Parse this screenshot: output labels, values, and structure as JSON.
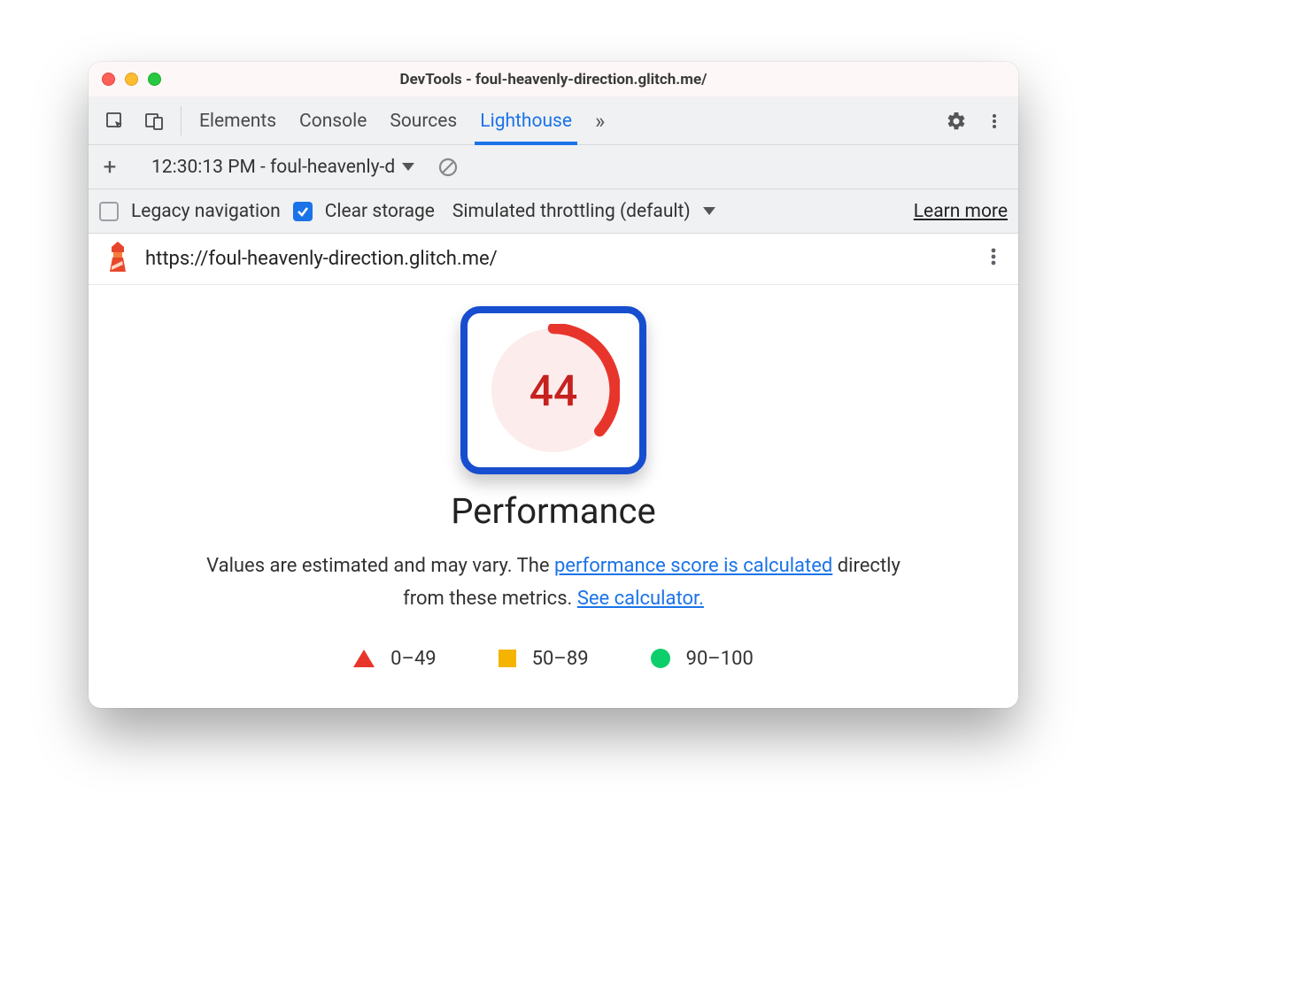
{
  "window": {
    "title": "DevTools - foul-heavenly-direction.glitch.me/"
  },
  "tabs": {
    "items": [
      "Elements",
      "Console",
      "Sources",
      "Lighthouse"
    ],
    "active": "Lighthouse"
  },
  "subbar1": {
    "report_select": "12:30:13 PM - foul-heavenly-d"
  },
  "subbar2": {
    "legacy_label": "Legacy navigation",
    "clear_label": "Clear storage",
    "throttling_label": "Simulated throttling (default)",
    "learn_more": "Learn more"
  },
  "url": "https://foul-heavenly-direction.glitch.me/",
  "report": {
    "score": 44,
    "category": "Performance",
    "desc_prefix": "Values are estimated and may vary. The ",
    "link1": "performance score is calculated",
    "desc_mid": " directly from these metrics. ",
    "link2": "See calculator."
  },
  "legend": {
    "low": "0–49",
    "mid": "50–89",
    "high": "90–100"
  }
}
